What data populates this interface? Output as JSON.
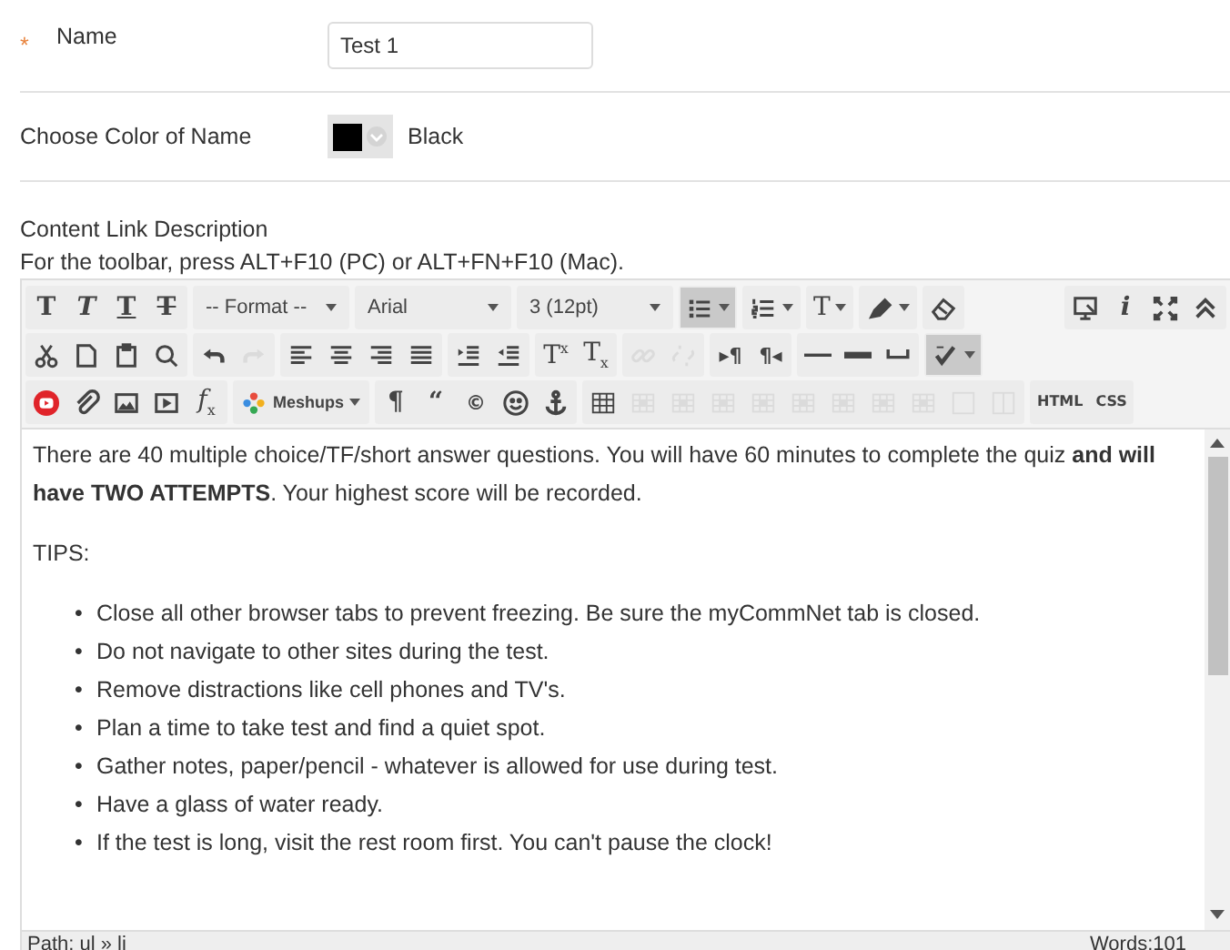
{
  "name_field": {
    "label": "Name",
    "required_mark": "*",
    "value": "Test 1"
  },
  "color_field": {
    "label": "Choose Color of Name",
    "color": "#000000",
    "value": "Black"
  },
  "description": {
    "label": "Content Link Description",
    "hint": "For the toolbar, press ALT+F10 (PC) or ALT+FN+F10 (Mac)."
  },
  "toolbar": [
    [
      [
        {
          "kind": "bold",
          "label": "T",
          "pressed": false,
          "disabled": false
        },
        {
          "kind": "italic",
          "label": "T",
          "pressed": false,
          "disabled": false
        },
        {
          "kind": "underline",
          "label": "T",
          "pressed": false,
          "disabled": false
        },
        {
          "kind": "strike",
          "label": "T",
          "pressed": false,
          "disabled": false
        }
      ],
      [
        {
          "kind": "select",
          "label": "-- Format --"
        }
      ],
      [
        {
          "kind": "select",
          "label": "Arial"
        }
      ],
      [
        {
          "kind": "select",
          "label": "3 (12pt)"
        }
      ],
      [
        {
          "kind": "list-bullet",
          "split": true,
          "pressed": true,
          "disabled": false
        }
      ],
      [
        {
          "kind": "list-number",
          "split": true,
          "pressed": false,
          "disabled": false
        }
      ],
      [
        {
          "kind": "text-color",
          "label": "T",
          "split": true,
          "pressed": false,
          "disabled": false
        }
      ],
      [
        {
          "kind": "highlight",
          "split": true,
          "pressed": false,
          "disabled": false
        }
      ],
      [
        {
          "kind": "eraser",
          "pressed": false,
          "disabled": false
        }
      ],
      [
        {
          "kind": "preview",
          "pressed": false,
          "disabled": false
        },
        {
          "kind": "info",
          "label": "i",
          "pressed": false,
          "disabled": false
        },
        {
          "kind": "fullscreen",
          "pressed": false,
          "disabled": false
        },
        {
          "kind": "collapse",
          "pressed": false,
          "disabled": false
        }
      ]
    ],
    [
      [
        {
          "kind": "cut",
          "pressed": false,
          "disabled": false
        },
        {
          "kind": "copy",
          "pressed": false,
          "disabled": false
        },
        {
          "kind": "paste",
          "pressed": false,
          "disabled": false
        },
        {
          "kind": "find",
          "pressed": false,
          "disabled": false
        }
      ],
      [
        {
          "kind": "undo",
          "pressed": false,
          "disabled": false
        },
        {
          "kind": "redo",
          "pressed": false,
          "disabled": true
        }
      ],
      [
        {
          "kind": "align-left",
          "pressed": false,
          "disabled": false
        },
        {
          "kind": "align-center",
          "pressed": false,
          "disabled": false
        },
        {
          "kind": "align-right",
          "pressed": false,
          "disabled": false
        },
        {
          "kind": "align-justify",
          "pressed": false,
          "disabled": false
        }
      ],
      [
        {
          "kind": "indent",
          "pressed": false,
          "disabled": false
        },
        {
          "kind": "outdent",
          "pressed": false,
          "disabled": false
        }
      ],
      [
        {
          "kind": "superscript",
          "label": "T$^{x}$",
          "pressed": false,
          "disabled": false
        },
        {
          "kind": "subscript",
          "label": "T$_{x}$",
          "pressed": false,
          "disabled": false
        }
      ],
      [
        {
          "kind": "link",
          "pressed": false,
          "disabled": true
        },
        {
          "kind": "unlink",
          "pressed": false,
          "disabled": true
        }
      ],
      [
        {
          "kind": "ltr",
          "label": "▸¶",
          "pressed": false,
          "disabled": false
        },
        {
          "kind": "rtl",
          "label": "¶◂",
          "pressed": false,
          "disabled": false
        }
      ],
      [
        {
          "kind": "hr",
          "pressed": false,
          "disabled": false
        },
        {
          "kind": "hr-thick",
          "pressed": false,
          "disabled": false
        },
        {
          "kind": "nbsp",
          "pressed": false,
          "disabled": false
        }
      ],
      [
        {
          "kind": "spellcheck",
          "split": true,
          "pressed": true,
          "disabled": false
        }
      ]
    ],
    [
      [
        {
          "kind": "youtube",
          "pressed": false,
          "disabled": false
        },
        {
          "kind": "attach",
          "pressed": false,
          "disabled": false
        },
        {
          "kind": "image",
          "pressed": false,
          "disabled": false
        },
        {
          "kind": "media",
          "pressed": false,
          "disabled": false
        },
        {
          "kind": "function",
          "label": "*f*$_{x}$",
          "pressed": false,
          "disabled": false
        }
      ],
      [
        {
          "kind": "mashups",
          "label": "Meshups",
          "split": true,
          "pressed": false,
          "disabled": false
        }
      ],
      [
        {
          "kind": "pilcrow",
          "label": "¶",
          "pressed": false,
          "disabled": false
        },
        {
          "kind": "quote",
          "label": "“",
          "pressed": false,
          "disabled": false
        },
        {
          "kind": "copyright",
          "label": "©",
          "pressed": false,
          "disabled": false
        },
        {
          "kind": "smiley",
          "pressed": false,
          "disabled": false
        },
        {
          "kind": "anchor",
          "pressed": false,
          "disabled": false
        }
      ],
      [
        {
          "kind": "table",
          "pressed": false,
          "disabled": false
        },
        {
          "kind": "table-op",
          "pressed": false,
          "disabled": true
        },
        {
          "kind": "table-op",
          "pressed": false,
          "disabled": true
        },
        {
          "kind": "table-op",
          "pressed": false,
          "disabled": true
        },
        {
          "kind": "table-op",
          "pressed": false,
          "disabled": true
        },
        {
          "kind": "table-op",
          "pressed": false,
          "disabled": true
        },
        {
          "kind": "table-op",
          "pressed": false,
          "disabled": true
        },
        {
          "kind": "table-op",
          "pressed": false,
          "disabled": true
        },
        {
          "kind": "table-op",
          "pressed": false,
          "disabled": true
        },
        {
          "kind": "cell",
          "pressed": false,
          "disabled": true
        },
        {
          "kind": "cell-split",
          "pressed": false,
          "disabled": true
        }
      ],
      [
        {
          "kind": "html",
          "label": "HTML",
          "pressed": false,
          "disabled": false
        },
        {
          "kind": "css",
          "label": "CSS",
          "pressed": false,
          "disabled": false
        }
      ]
    ]
  ],
  "content": {
    "intro": "There are 40 multiple choice/TF/short answer questions. You will have 60 minutes to complete the quiz **and will have TWO ATTEMPTS**. Your highest score will be recorded.",
    "heading": "TIPS:",
    "tips": [
      {
        "bullet": "•",
        "text": "Close all other browser tabs to prevent freezing. Be sure the myCommNet tab is closed."
      },
      {
        "bullet": "•",
        "text": "Do not navigate to other sites during the test."
      },
      {
        "bullet": "•",
        "text": "Remove distractions like cell phones and TV's."
      },
      {
        "bullet": "•",
        "text": "Plan a time to take test and find a quiet spot."
      },
      {
        "bullet": "•",
        "text": "Gather notes, paper/pencil - whatever is allowed for use during test."
      },
      {
        "bullet": "•",
        "text": "Have a glass of water ready."
      },
      {
        "bullet": "•",
        "text": "If the test is long, visit the rest room first. You can't pause the clock!"
      }
    ]
  },
  "status_bar": {
    "path": "Path: ul » li",
    "words": "Words:101"
  }
}
